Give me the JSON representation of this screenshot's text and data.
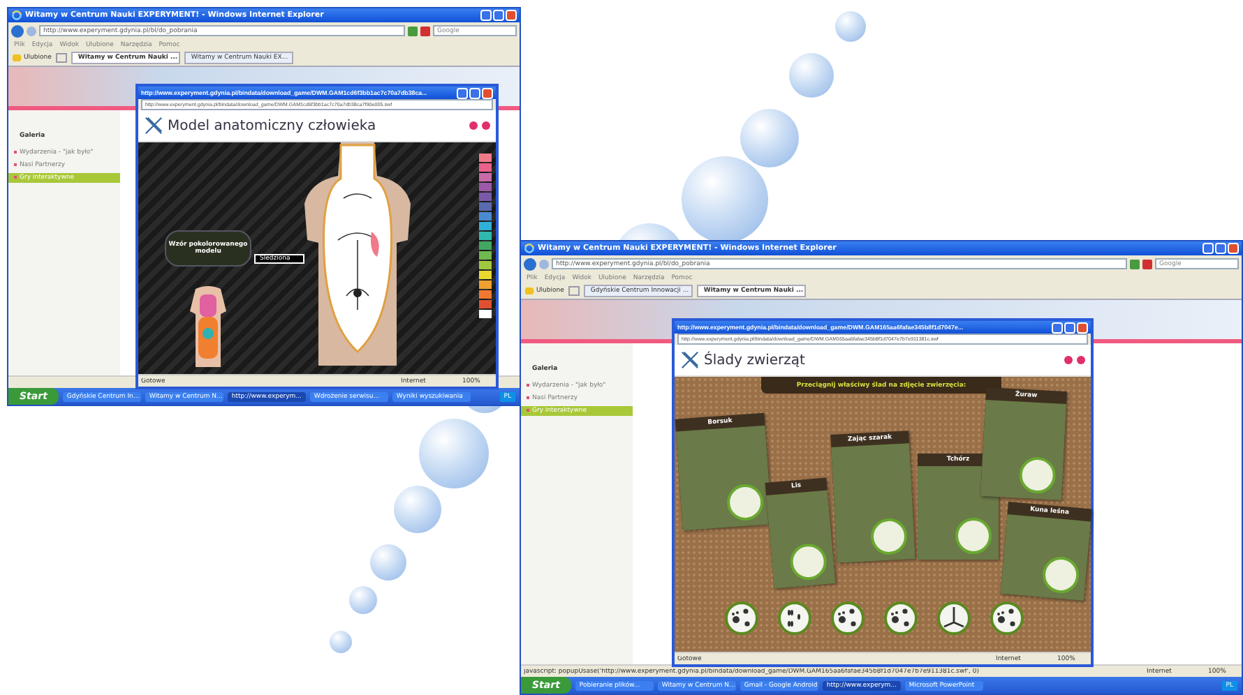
{
  "windows": [
    {
      "title": "Witamy w Centrum Nauki EXPERYMENT! - Windows Internet Explorer",
      "url": "http://www.experyment.gdynia.pl/bl/do_pobrania",
      "search_placeholder": "Google",
      "menu": [
        "Plik",
        "Edycja",
        "Widok",
        "Ulubione",
        "Narzędzia",
        "Pomoc"
      ],
      "favorites": "Ulubione",
      "tabs": [
        {
          "label": "Witamy w Centrum Nauki ...",
          "selected": true
        },
        {
          "label": "Witamy w Centrum Nauki EX...",
          "selected": false
        }
      ],
      "sidebar": {
        "heading": "Galeria",
        "items": [
          {
            "label": "Wydarzenia - \"jak było\"",
            "selected": false
          },
          {
            "label": "Nasi Partnerzy",
            "selected": false
          },
          {
            "label": "Gry interaktywne",
            "selected": true
          }
        ]
      },
      "popup": {
        "kind": "anatomy",
        "title": "http://www.experyment.gdynia.pl/bindata/download_game/DWM.GAM1cd6f3bb1ac7c70a7db38ca...",
        "url": "http://www.experyment.gdynia.pl/bindata/download_game/DWM.GAM1cd6f3bb1ac7c70a7db38ca7f90e005.swf",
        "heading": "Model anatomiczny człowieka",
        "tooltip": "Wzór pokolorowanego modelu",
        "organ_label": "Śledziona",
        "palette": [
          {
            "color": "#f07a8a"
          },
          {
            "color": "#e9628a"
          },
          {
            "color": "#c86aa8"
          },
          {
            "color": "#9a5aa8"
          },
          {
            "color": "#7a5aa8"
          },
          {
            "color": "#5a6ab0"
          },
          {
            "color": "#4a8ad0"
          },
          {
            "color": "#30b0d8"
          },
          {
            "color": "#30b8b0"
          },
          {
            "color": "#40a860"
          },
          {
            "color": "#70b850"
          },
          {
            "color": "#a0c840"
          },
          {
            "color": "#e8d830"
          },
          {
            "color": "#f0a030"
          },
          {
            "color": "#f07830"
          },
          {
            "color": "#e05030"
          },
          {
            "color": "#ffffff"
          }
        ],
        "status": {
          "text": "Gotowe",
          "zone": "Internet",
          "zoom": "100%"
        }
      },
      "taskbar": {
        "start": "Start",
        "items": [
          {
            "label": "Gdyńskie Centrum In...",
            "selected": false
          },
          {
            "label": "Witamy w Centrum N...",
            "selected": false
          },
          {
            "label": "http://www.experym...",
            "selected": true
          },
          {
            "label": "Wdrożenie serwisu...",
            "selected": false
          },
          {
            "label": "Wyniki wyszukiwania",
            "selected": false
          }
        ],
        "tray": "PL"
      }
    },
    {
      "title": "Witamy w Centrum Nauki EXPERYMENT! - Windows Internet Explorer",
      "url": "http://www.experyment.gdynia.pl/bl/do_pobrania",
      "search_placeholder": "Google",
      "menu": [
        "Plik",
        "Edycja",
        "Widok",
        "Ulubione",
        "Narzędzia",
        "Pomoc"
      ],
      "favorites": "Ulubione",
      "tabs": [
        {
          "label": "Gdyńskie Centrum Innowacji ...",
          "selected": false
        },
        {
          "label": "Witamy w Centrum Nauki ...",
          "selected": true
        }
      ],
      "sidebar": {
        "heading": "Galeria",
        "items": [
          {
            "label": "Wydarzenia - \"jak było\"",
            "selected": false
          },
          {
            "label": "Nasi Partnerzy",
            "selected": false
          },
          {
            "label": "Gry interaktywne",
            "selected": true
          }
        ]
      },
      "popup": {
        "kind": "tracks",
        "title": "http://www.experyment.gdynia.pl/bindata/download_game/DWM.GAM165aa6fafae345b8f1d7047e...",
        "url": "http://www.experyment.gdynia.pl/bindata/download_game/DWM.GAM165aa6fafae345b8f1d7047e7b7e911381c.swf",
        "heading": "Ślady zwierząt",
        "instruction": "Przeciągnij właściwy ślad na zdjęcie zwierzęcia:",
        "cards": [
          {
            "name": "Borsuk"
          },
          {
            "name": "Lis"
          },
          {
            "name": "Zając szarak"
          },
          {
            "name": "Tchórz"
          },
          {
            "name": "Żuraw"
          },
          {
            "name": "Kuna leśna"
          }
        ],
        "tracks": [
          {
            "kind": "paw"
          },
          {
            "kind": "hoof"
          },
          {
            "kind": "paw"
          },
          {
            "kind": "paw"
          },
          {
            "kind": "bird"
          },
          {
            "kind": "paw"
          }
        ],
        "status": {
          "text": "Gotowe",
          "zone": "Internet",
          "zoom": "100%"
        }
      },
      "status": {
        "text": "javascript: popupUsase('http://www.experyment.gdynia.pl/bindata/download_game/DWM.GAM165aa6fafae345b8f1d7047e7b7e911381c.swf', 0)",
        "zone": "Internet",
        "zoom": "100%"
      },
      "taskbar": {
        "start": "Start",
        "items": [
          {
            "label": "Pobieranie plików...",
            "selected": false
          },
          {
            "label": "Witamy w Centrum N...",
            "selected": false
          },
          {
            "label": "Gmail - Google Android",
            "selected": false
          },
          {
            "label": "http://www.experym...",
            "selected": true
          },
          {
            "label": "Microsoft PowerPoint",
            "selected": false
          }
        ],
        "tray": "PL"
      }
    }
  ]
}
